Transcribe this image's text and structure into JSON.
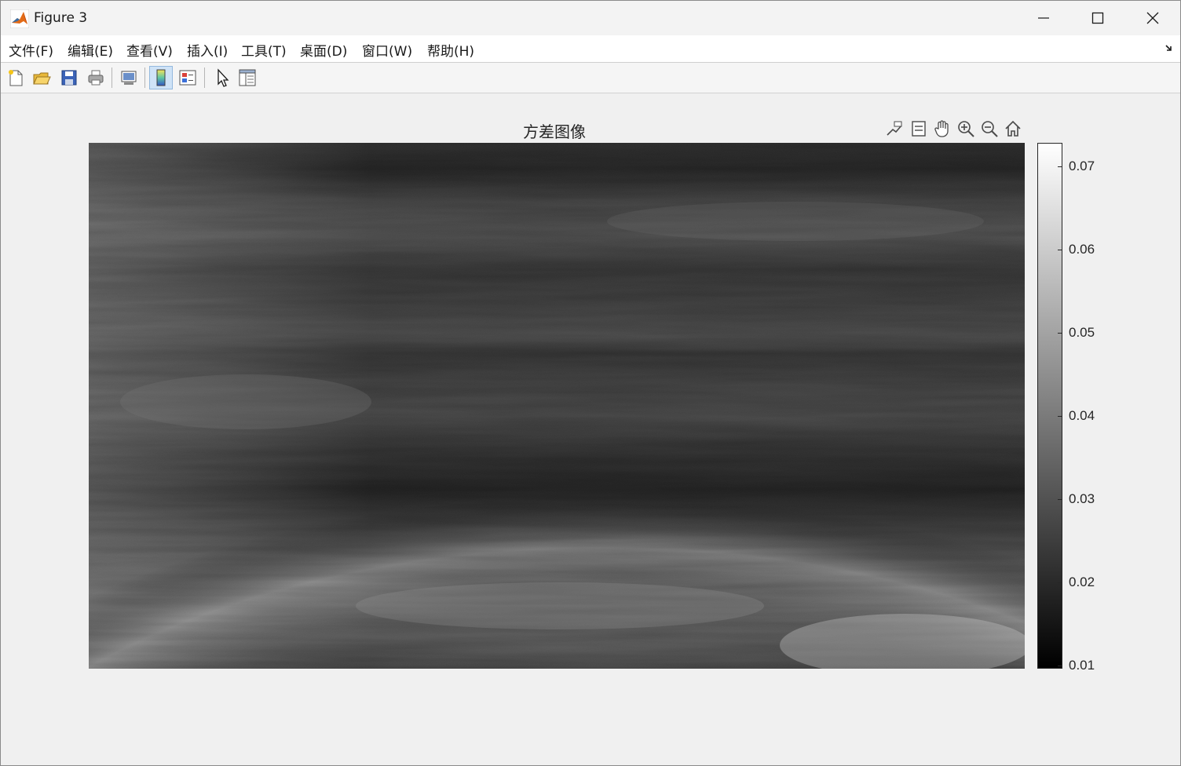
{
  "window": {
    "title": "Figure 3"
  },
  "menu": [
    {
      "label": "文件(F)"
    },
    {
      "label": "编辑(E)"
    },
    {
      "label": "查看(V)"
    },
    {
      "label": "插入(I)"
    },
    {
      "label": "工具(T)"
    },
    {
      "label": "桌面(D)"
    },
    {
      "label": "窗口(W)"
    },
    {
      "label": "帮助(H)"
    }
  ],
  "toolbar": {
    "buttons": [
      "new-figure-icon",
      "open-file-icon",
      "save-icon",
      "print-icon",
      "link-plot-icon",
      "colorbar-icon",
      "legend-icon",
      "edit-plot-icon",
      "property-inspector-icon"
    ],
    "active": "colorbar-icon"
  },
  "axes": {
    "title": "方差图像",
    "toolbar": [
      "data-tips-icon",
      "data-brush-icon",
      "pan-icon",
      "zoom-in-icon",
      "zoom-out-icon",
      "home-icon"
    ]
  },
  "colorbar": {
    "colormap": "gray",
    "ticks": [
      "0.07",
      "0.06",
      "0.05",
      "0.04",
      "0.03",
      "0.02",
      "0.01"
    ],
    "range": [
      0.01,
      0.072
    ]
  },
  "colors": {
    "background": "#f0f0f0",
    "menubar": "#ffffff",
    "active_toggle": "#cfe3f7",
    "text": "#262626"
  }
}
